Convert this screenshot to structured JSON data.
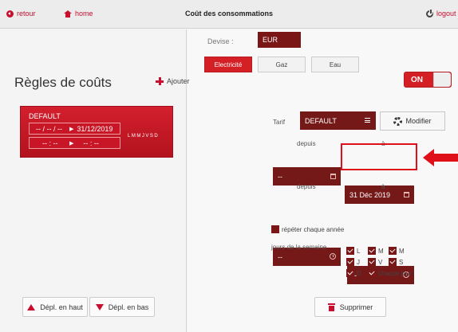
{
  "header": {
    "back_label": "retour",
    "home_label": "home",
    "title": "Coût des consommations",
    "logout_label": "logout"
  },
  "left": {
    "title": "Règles de coûts",
    "add_label": "Ajouter",
    "rule": {
      "name": "DEFAULT",
      "date_from": "-- / -- / --",
      "date_to": "31/12/2019",
      "time_from": "-- : --",
      "time_to": "-- : --",
      "days": "LMMJVSD"
    },
    "move_up_label": "Dépl. en haut",
    "move_down_label": "Dépl. en bas"
  },
  "right": {
    "currency_label": "Devise :",
    "currency_value": "EUR",
    "energy_tabs": [
      {
        "label": "Electricité",
        "active": true
      },
      {
        "label": "Gaz",
        "active": false
      },
      {
        "label": "Eau",
        "active": false
      }
    ],
    "toggle_label": "ON",
    "tariff_label": "Tarif",
    "tariff_value": "DEFAULT",
    "modify_label": "Modifier",
    "since_label": "depuis",
    "to_label": "à",
    "date_from_value": "--",
    "date_to_value": "31 Déc 2019",
    "time_since_label": "depuis",
    "time_to_label": "à",
    "time_from_value": "--",
    "time_to_value": "--",
    "repeat_label": "répéter chaque année",
    "weekdays_label": "jours de la semaine",
    "days": [
      "L",
      "M",
      "M",
      "J",
      "V",
      "S",
      "D"
    ],
    "every_day_label": "chaque jour",
    "delete_label": "Supprimer"
  },
  "colors": {
    "accent": "#c8102e",
    "dark_input": "#751818"
  }
}
